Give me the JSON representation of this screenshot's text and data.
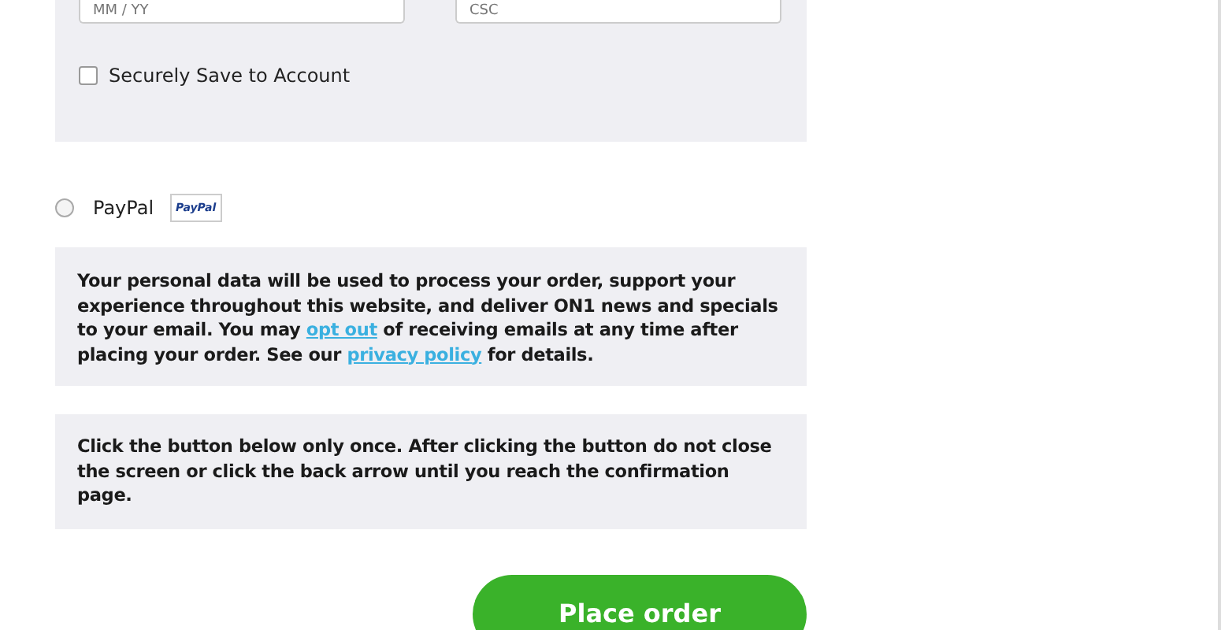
{
  "card_form": {
    "expiry": {
      "placeholder": "MM / YY"
    },
    "csc": {
      "placeholder": "CSC"
    },
    "save_to_account": {
      "label": "Securely Save to Account",
      "checked": false
    }
  },
  "payment_options": [
    {
      "label": "PayPal",
      "selected": false,
      "logo": "PayPal"
    }
  ],
  "privacy_notice": {
    "parts": [
      {
        "kind": "text",
        "text": "Your personal data will be used to process your order, support your experience throughout this website, and deliver ON1 news and specials to your email. You may "
      },
      {
        "kind": "link",
        "text": "opt out"
      },
      {
        "kind": "text",
        "text": " of receiving emails at any time after placing your order. See our "
      },
      {
        "kind": "link",
        "text": "privacy policy"
      },
      {
        "kind": "text",
        "text": " for details."
      }
    ]
  },
  "click_notice": "Click the button below only once. After clicking the button do not close the screen or click the back arrow until you reach the confirmation page.",
  "place_order_button": "Place order"
}
